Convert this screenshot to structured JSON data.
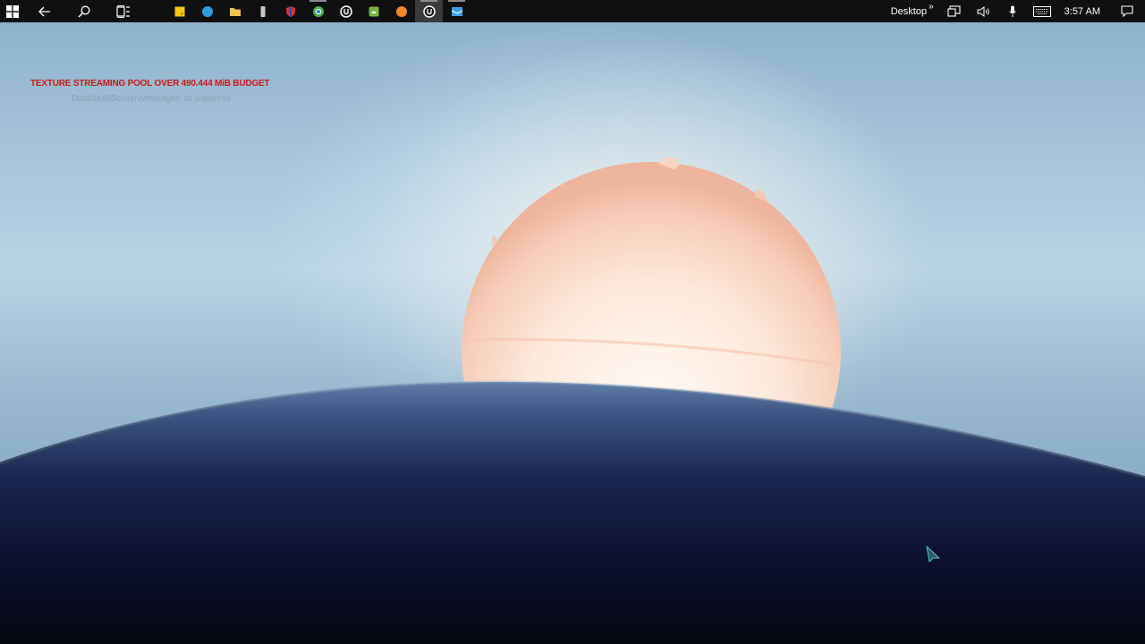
{
  "taskbar": {
    "apps": [
      {
        "name": "sticky-notes-icon",
        "color": "#f2c811",
        "running": false,
        "active": false
      },
      {
        "name": "edge-browser-icon",
        "color": "#2f9be0",
        "running": false,
        "active": false
      },
      {
        "name": "file-explorer-icon",
        "color": "#f0c24a",
        "running": false,
        "active": false
      },
      {
        "name": "usb-drive-icon",
        "color": "#c9c9c9",
        "running": false,
        "active": false
      },
      {
        "name": "shield-app-icon",
        "color": "#d9312b",
        "running": false,
        "active": false
      },
      {
        "name": "chrome-browser-icon",
        "color": "#4caf50",
        "running": true,
        "active": false
      },
      {
        "name": "unreal-engine-icon",
        "color": "#ffffff",
        "running": false,
        "active": false
      },
      {
        "name": "android-app-icon",
        "color": "#7cb342",
        "running": false,
        "active": false
      },
      {
        "name": "blender-icon",
        "color": "#f08a24",
        "running": false,
        "active": false
      },
      {
        "name": "unreal-engine-running-icon",
        "color": "#ffffff",
        "running": true,
        "active": true
      },
      {
        "name": "mail-app-icon",
        "color": "#3aa0e8",
        "running": true,
        "active": false
      }
    ],
    "tray": {
      "toolbar_label": "Desktop",
      "chevron": "»",
      "time": "3:57 AM"
    }
  },
  "overlay": {
    "warning": "TEXTURE STREAMING POOL OVER 490.444 MiB BUDGET",
    "hint": "'DisableAllScreenMessages' to suppress"
  },
  "colors": {
    "warning": "#d01818",
    "taskbar": "#101010",
    "sun": "#fbe4d6",
    "planet_top": "#5a77a0",
    "planet_bottom": "#070a18"
  }
}
